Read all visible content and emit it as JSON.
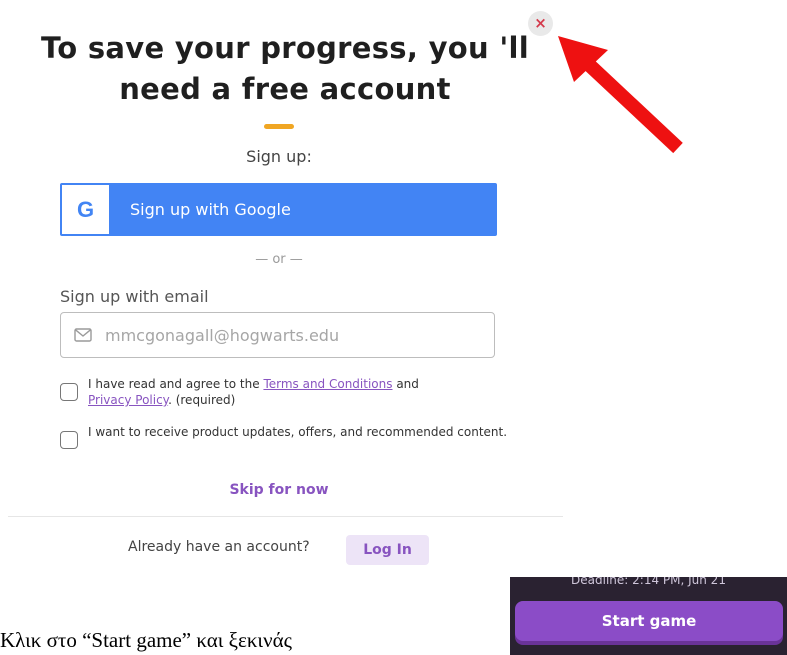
{
  "dialog": {
    "title": "To save your progress, you 'll need a free account",
    "close_label": "×",
    "signup_label": "Sign up:",
    "google_letter": "G",
    "google_button": "Sign up with Google",
    "or_divider": "— or —",
    "email_label": "Sign up with email",
    "email_placeholder": "mmcgonagall@hogwarts.edu",
    "terms_prefix": "I have read and agree to the ",
    "terms_link": "Terms and Conditions",
    "terms_and": " and",
    "privacy_link": "Privacy Policy",
    "terms_suffix": ". (required)",
    "updates_text": "I want to receive product updates, offers, and recommended content.",
    "skip": "Skip for now",
    "already": "Already have an account?",
    "login": "Log In"
  },
  "game_panel": {
    "deadline": "Deadline: 2:14 PM, Jun 21",
    "start_button": "Start game"
  },
  "caption": "Κλικ στο “Start game” και ξεκινάς",
  "icons": {
    "close": "close-icon",
    "google": "google-icon",
    "mail": "mail-icon",
    "arrow": "red-arrow-icon"
  },
  "colors": {
    "accent_purple": "#8854c0",
    "google_blue": "#4284f4",
    "accent_orange": "#f0a623",
    "arrow_red": "#ee1111",
    "close_red": "#d43a4c"
  }
}
